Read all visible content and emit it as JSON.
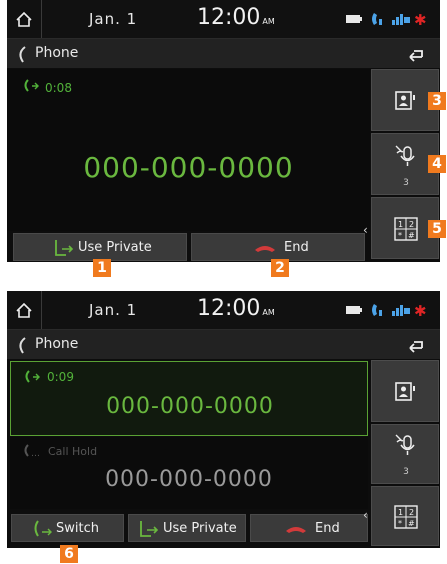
{
  "status": {
    "date": "Jan. 1",
    "time": "12:00",
    "ampm": "AM"
  },
  "header": {
    "title": "Phone"
  },
  "screen1": {
    "duration": "0:08",
    "number": "000-000-0000",
    "use_private_label": "Use Private",
    "end_label": "End",
    "mic_count": "3"
  },
  "screen2": {
    "active_duration": "0:09",
    "active_number": "000-000-0000",
    "hold_label": "Call Hold",
    "hold_number": "000-000-0000",
    "switch_label": "Switch",
    "use_private_label": "Use Private",
    "end_label": "End",
    "mic_count": "3"
  },
  "markers": [
    "1",
    "2",
    "3",
    "4",
    "5",
    "6"
  ],
  "colors": {
    "accent_green": "#6ab83f",
    "end_red": "#d23a3a",
    "marker_orange": "#f07a1e"
  }
}
